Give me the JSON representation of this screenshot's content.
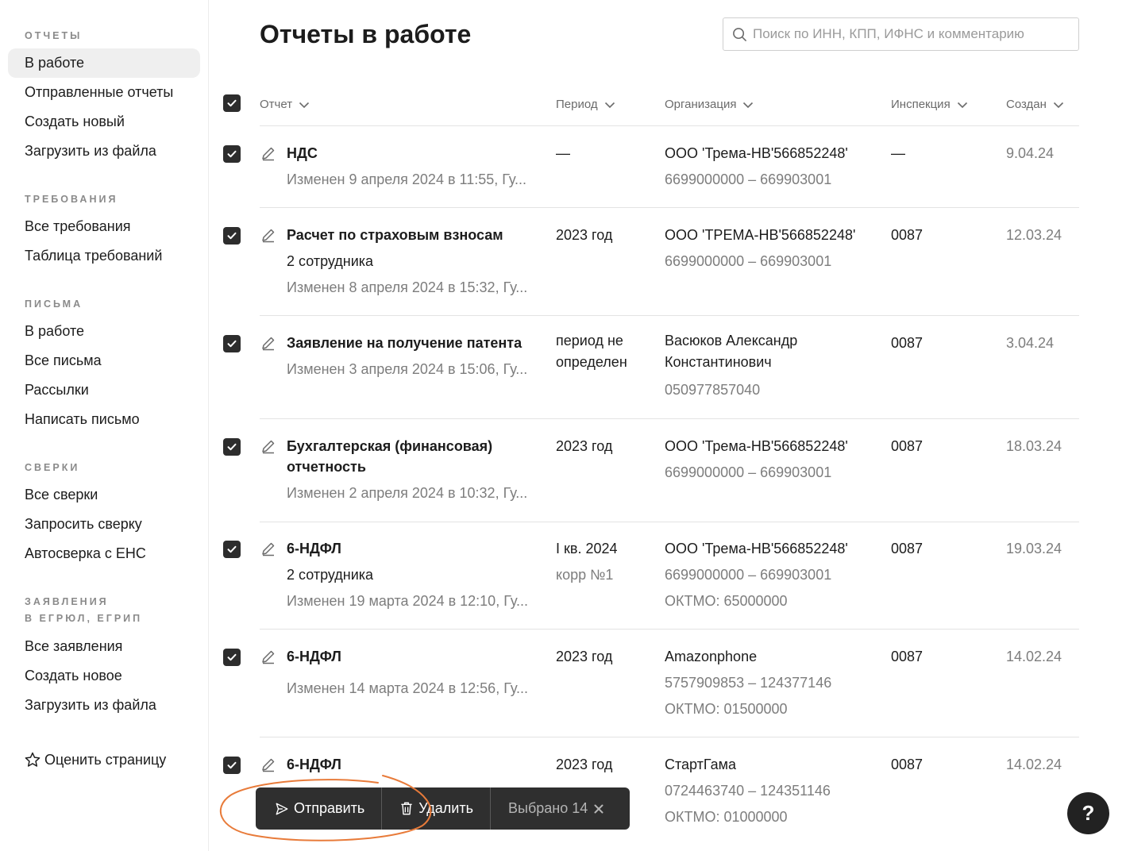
{
  "sidebar": {
    "sections": [
      {
        "title": "ОТЧЕТЫ",
        "items": [
          "В работе",
          "Отправленные отчеты",
          "Создать новый",
          "Загрузить из файла"
        ]
      },
      {
        "title": "ТРЕБОВАНИЯ",
        "items": [
          "Все требования",
          "Таблица требований"
        ]
      },
      {
        "title": "ПИСЬМА",
        "items": [
          "В работе",
          "Все письма",
          "Рассылки",
          "Написать письмо"
        ]
      },
      {
        "title": "СВЕРКИ",
        "items": [
          "Все сверки",
          "Запросить сверку",
          "Автосверка с ЕНС"
        ]
      },
      {
        "title_line1": "ЗАЯВЛЕНИЯ",
        "title_line2": "В ЕГРЮЛ, ЕГРИП",
        "items": [
          "Все заявления",
          "Создать новое",
          "Загрузить из файла"
        ]
      }
    ],
    "rate_label": "Оценить страницу"
  },
  "header": {
    "title": "Отчеты в работе",
    "search_placeholder": "Поиск по ИНН, КПП, ИФНС и комментарию"
  },
  "table": {
    "columns": [
      "Отчет",
      "Период",
      "Организация",
      "Инспекция",
      "Создан"
    ],
    "rows": [
      {
        "name_line1": "НДС",
        "name_line2": "",
        "sub": "",
        "changed": "Изменен 9 апреля 2024 в 11:55, Гу...",
        "period": "—",
        "period2": "",
        "org": "ООО 'Трема-НВ'566852248'",
        "org2": "",
        "org_ids": "6699000000 – 669903001",
        "oktmo": "",
        "inspection": "—",
        "created": "9.04.24"
      },
      {
        "name_line1": "Расчет по страховым взносам",
        "name_line2": "",
        "sub": "2 сотрудника",
        "changed": "Изменен 8 апреля 2024 в 15:32, Гу...",
        "period": "2023 год",
        "period2": "",
        "org": "ООО 'ТРЕМА-НВ'566852248'",
        "org2": "",
        "org_ids": "6699000000 – 669903001",
        "oktmo": "",
        "inspection": "0087",
        "created": "12.03.24"
      },
      {
        "name_line1": "Заявление на получение патента",
        "name_line2": "",
        "sub": "",
        "changed": "Изменен 3 апреля 2024 в 15:06, Гу...",
        "period": "период не",
        "period2": "определен",
        "org": "Васюков Александр",
        "org2": "Константинович",
        "org_ids": "050977857040",
        "oktmo": "",
        "inspection": "0087",
        "created": "3.04.24"
      },
      {
        "name_line1": "Бухгалтерская (финансовая)",
        "name_line2": "отчетность",
        "sub": "",
        "changed": "Изменен 2 апреля 2024 в 10:32, Гу...",
        "period": "2023 год",
        "period2": "",
        "org": "ООО 'Трема-НВ'566852248'",
        "org2": "",
        "org_ids": "6699000000 – 669903001",
        "oktmo": "",
        "inspection": "0087",
        "created": "18.03.24"
      },
      {
        "name_line1": "6-НДФЛ",
        "name_line2": "",
        "sub": "2 сотрудника",
        "changed": "Изменен 19 марта 2024 в 12:10, Гу...",
        "period": "I кв. 2024",
        "period2": "корр №1",
        "org": "ООО 'Трема-НВ'566852248'",
        "org2": "",
        "org_ids": "6699000000 – 669903001",
        "oktmo": "ОКТМО: 65000000",
        "inspection": "0087",
        "created": "19.03.24"
      },
      {
        "name_line1": "6-НДФЛ",
        "name_line2": "",
        "sub": "",
        "changed": "Изменен 14 марта 2024 в 12:56, Гу...",
        "period": "2023 год",
        "period2": "",
        "org": "Amazonphone",
        "org2": "",
        "org_ids": "5757909853 – 124377146",
        "oktmo": "ОКТМО: 01500000",
        "inspection": "0087",
        "created": "14.02.24"
      },
      {
        "name_line1": "6-НДФЛ",
        "name_line2": "",
        "sub": "",
        "changed": "",
        "period": "2023 год",
        "period2": "",
        "org": "СтартГама",
        "org2": "",
        "org_ids": "0724463740 – 124351146",
        "oktmo": "ОКТМО: 01000000",
        "inspection": "0087",
        "created": "14.02.24"
      }
    ]
  },
  "actionbar": {
    "send_label": "Отправить",
    "delete_label": "Удалить",
    "selected_label": "Выбрано 14"
  },
  "help_label": "?"
}
